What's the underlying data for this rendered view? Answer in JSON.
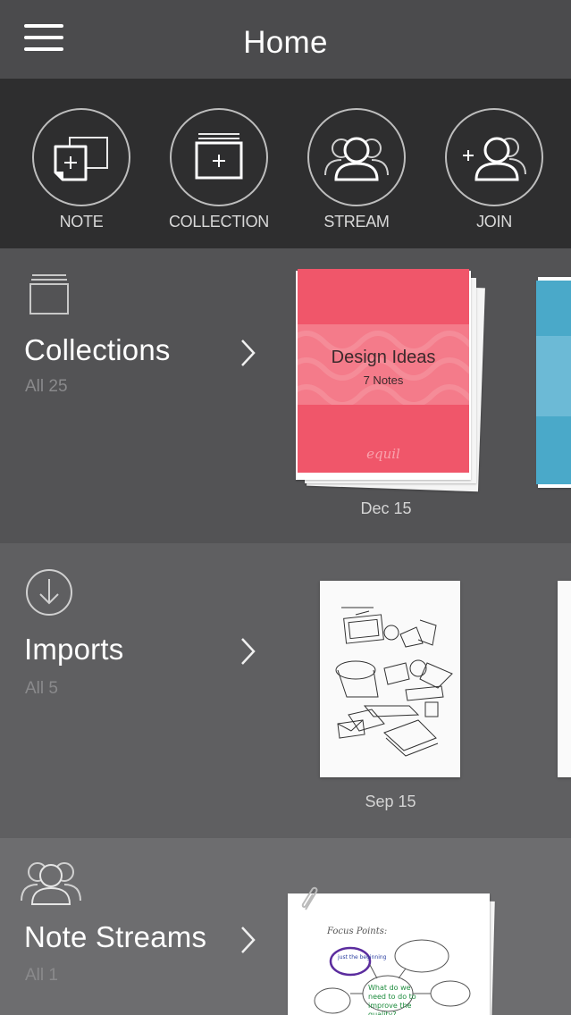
{
  "header": {
    "title": "Home",
    "menu_icon": "hamburger-menu-icon"
  },
  "actions": [
    {
      "label": "NOTE",
      "icon": "add-note-icon"
    },
    {
      "label": "COLLECTION",
      "icon": "add-collection-icon"
    },
    {
      "label": "STREAM",
      "icon": "stream-people-icon"
    },
    {
      "label": "JOIN",
      "icon": "join-person-icon"
    }
  ],
  "collections": {
    "title": "Collections",
    "count": "All 25",
    "icon": "collection-stack-icon",
    "cards": [
      {
        "title": "Design Ideas",
        "subtitle": "7 Notes",
        "brand": "equil",
        "date": "Dec 15",
        "color": "#f0566a"
      }
    ],
    "peek_color": "#4aa9c9"
  },
  "imports": {
    "title": "Imports",
    "count": "All 5",
    "icon": "download-circle-icon",
    "cards": [
      {
        "date": "Sep 15"
      }
    ]
  },
  "note_streams": {
    "title": "Note Streams",
    "count": "All 1",
    "icon": "people-group-icon",
    "note_text": {
      "heading": "Focus Points:",
      "circle": "just the beginning",
      "center": "What do we need to do to improve the quality?"
    }
  },
  "colors": {
    "accent_pink": "#f0566a",
    "accent_blue": "#4aa9c9",
    "header_bg": "#4b4b4d",
    "action_bar_bg": "#2e2e2f"
  }
}
